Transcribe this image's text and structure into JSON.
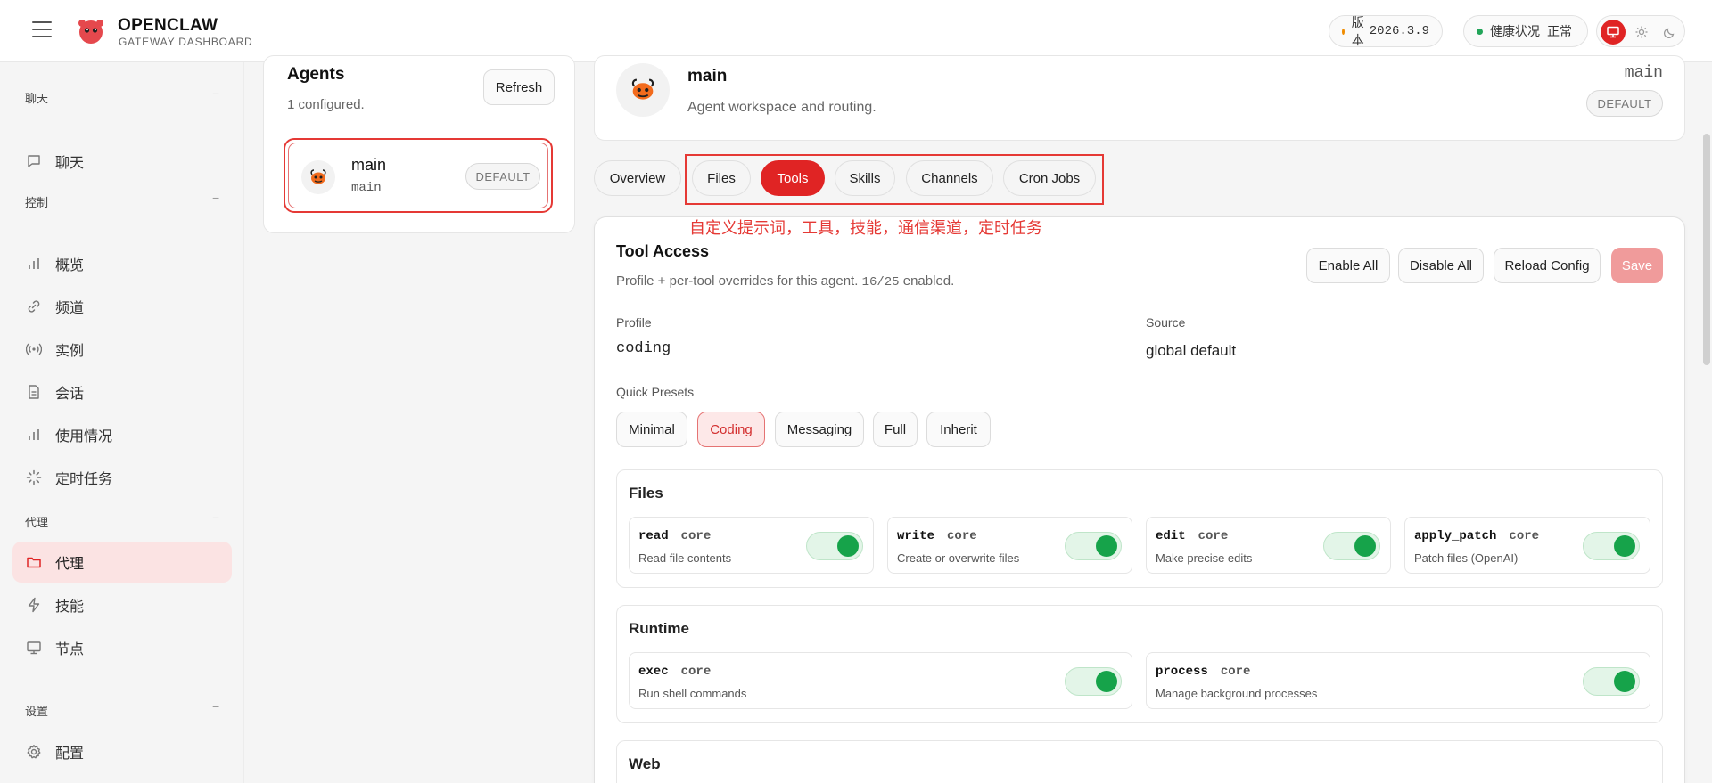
{
  "header": {
    "brand_title": "OPENCLAW",
    "brand_subtitle": "GATEWAY DASHBOARD",
    "version_label": "版本",
    "version_value": "2026.3.9",
    "health_label": "健康状况",
    "health_value": "正常",
    "colors": {
      "version_dot": "#f08c00",
      "health_dot": "#22a559",
      "accent": "#e02424"
    }
  },
  "sidebar": {
    "sections": [
      {
        "label": "聊天",
        "collapse": "−",
        "items": [
          {
            "label": "聊天",
            "icon": "chat-icon"
          }
        ]
      },
      {
        "label": "控制",
        "collapse": "−",
        "items": [
          {
            "label": "概览",
            "icon": "bar-chart-icon"
          },
          {
            "label": "频道",
            "icon": "link-icon"
          },
          {
            "label": "实例",
            "icon": "broadcast-icon"
          },
          {
            "label": "会话",
            "icon": "document-icon"
          },
          {
            "label": "使用情况",
            "icon": "bar-chart-icon"
          },
          {
            "label": "定时任务",
            "icon": "loader-icon"
          }
        ]
      },
      {
        "label": "代理",
        "collapse": "−",
        "items": [
          {
            "label": "代理",
            "icon": "folder-icon",
            "active": true
          },
          {
            "label": "技能",
            "icon": "lightning-icon"
          },
          {
            "label": "节点",
            "icon": "monitor-icon"
          }
        ]
      },
      {
        "label": "设置",
        "collapse": "−",
        "items": [
          {
            "label": "配置",
            "icon": "gear-icon"
          }
        ]
      }
    ]
  },
  "agents": {
    "title": "Agents",
    "subtitle": "1 configured.",
    "refresh_label": "Refresh",
    "list": [
      {
        "name": "main",
        "id": "main",
        "badge": "DEFAULT"
      }
    ]
  },
  "agent_header": {
    "name": "main",
    "description": "Agent workspace and routing.",
    "id": "main",
    "badge": "DEFAULT"
  },
  "tabs": [
    {
      "label": "Overview"
    },
    {
      "label": "Files"
    },
    {
      "label": "Tools",
      "active": true
    },
    {
      "label": "Skills"
    },
    {
      "label": "Channels"
    },
    {
      "label": "Cron Jobs"
    }
  ],
  "annotation": "自定义提示词，工具，技能，通信渠道，定时任务",
  "tool_access": {
    "title": "Tool Access",
    "subtitle": "Profile + per-tool overrides for this agent.",
    "enabled_count": "16/25",
    "enabled_suffix": "enabled.",
    "buttons": {
      "enable_all": "Enable All",
      "disable_all": "Disable All",
      "reload": "Reload Config",
      "save": "Save"
    },
    "profile_label": "Profile",
    "profile_value": "coding",
    "source_label": "Source",
    "source_value": "global default",
    "presets_label": "Quick Presets",
    "presets": [
      {
        "label": "Minimal"
      },
      {
        "label": "Coding",
        "active": true
      },
      {
        "label": "Messaging"
      },
      {
        "label": "Full"
      },
      {
        "label": "Inherit"
      }
    ],
    "groups": [
      {
        "title": "Files",
        "tools": [
          {
            "name": "read",
            "tag": "core",
            "desc": "Read file contents",
            "enabled": true
          },
          {
            "name": "write",
            "tag": "core",
            "desc": "Create or overwrite files",
            "enabled": true
          },
          {
            "name": "edit",
            "tag": "core",
            "desc": "Make precise edits",
            "enabled": true
          },
          {
            "name": "apply_patch",
            "tag": "core",
            "desc": "Patch files (OpenAI)",
            "enabled": true
          }
        ]
      },
      {
        "title": "Runtime",
        "tools": [
          {
            "name": "exec",
            "tag": "core",
            "desc": "Run shell commands",
            "enabled": true
          },
          {
            "name": "process",
            "tag": "core",
            "desc": "Manage background processes",
            "enabled": true
          }
        ]
      },
      {
        "title": "Web",
        "tools": []
      }
    ]
  }
}
